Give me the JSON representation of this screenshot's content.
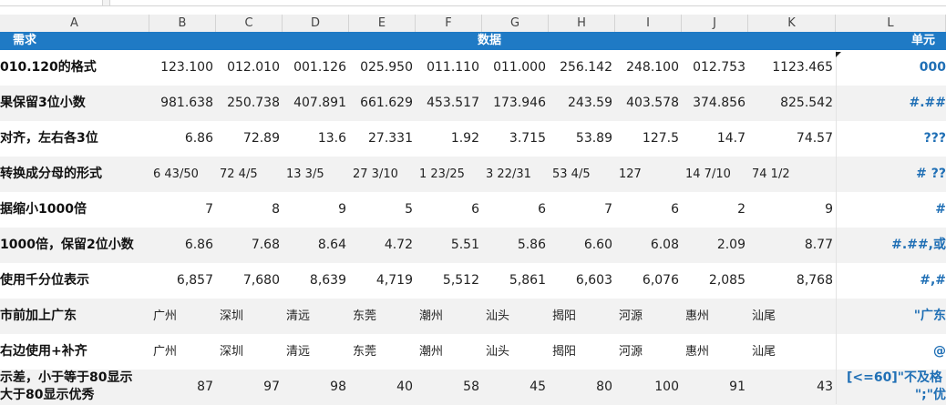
{
  "columns": [
    "A",
    "B",
    "C",
    "D",
    "E",
    "F",
    "G",
    "H",
    "I",
    "J",
    "K",
    "L"
  ],
  "banner": {
    "left": "需求",
    "center": "数据",
    "right": "单元格"
  },
  "rows": [
    {
      "label": "010.120的格式",
      "type": "num",
      "values": [
        "123.100",
        "012.010",
        "001.126",
        "025.950",
        "011.110",
        "011.000",
        "256.142",
        "248.100",
        "012.753",
        "1123.465"
      ],
      "format": "000",
      "alt": false
    },
    {
      "label": "果保留3位小数",
      "type": "num",
      "values": [
        "981.638",
        "250.738",
        "407.891",
        "661.629",
        "453.517",
        "173.946",
        "243.59",
        "403.578",
        "374.856",
        "825.542"
      ],
      "format": "#.##",
      "alt": true
    },
    {
      "label": "对齐，左右各3位",
      "type": "num",
      "values": [
        "6.86",
        "72.89",
        "13.6",
        "27.331",
        "1.92",
        "3.715",
        "53.89",
        "127.5",
        "14.7",
        "74.57"
      ],
      "format": "???",
      "alt": false
    },
    {
      "label": "转换成分母的形式",
      "type": "txt",
      "values": [
        "6 43/50",
        "72   4/5",
        "13   3/5",
        "27   3/10",
        "1 23/25",
        "3 22/31",
        "53   4/5",
        "127",
        "14   7/10",
        "74   1/2"
      ],
      "format": "# ??",
      "alt": true
    },
    {
      "label": "据缩小1000倍",
      "type": "num",
      "values": [
        "7",
        "8",
        "9",
        "5",
        "6",
        "6",
        "7",
        "6",
        "2",
        "9"
      ],
      "format": "#",
      "alt": false
    },
    {
      "label": "1000倍，保留2位小数",
      "type": "num",
      "values": [
        "6.86",
        "7.68",
        "8.64",
        "4.72",
        "5.51",
        "5.86",
        "6.60",
        "6.08",
        "2.09",
        "8.77"
      ],
      "format": "#.##,或",
      "alt": true
    },
    {
      "label": "使用千分位表示",
      "type": "num",
      "values": [
        "6,857",
        "7,680",
        "8,639",
        "4,719",
        "5,512",
        "5,861",
        "6,603",
        "6,076",
        "2,085",
        "8,768"
      ],
      "format": "#,#",
      "alt": false
    },
    {
      "label": "市前加上广东",
      "type": "txt",
      "values": [
        "广州",
        "深圳",
        "清远",
        "东莞",
        "潮州",
        "汕头",
        "揭阳",
        "河源",
        "惠州",
        "汕尾"
      ],
      "format": "\"广东",
      "alt": true
    },
    {
      "label": "右边使用+补齐",
      "type": "txt",
      "values": [
        "广州",
        "深圳",
        "清远",
        "东莞",
        "潮州",
        "汕头",
        "揭阳",
        "河源",
        "惠州",
        "汕尾"
      ],
      "format": "@",
      "alt": false
    },
    {
      "label": "示差，小于等于80显示",
      "label2": "大于80显示优秀",
      "type": "num",
      "values": [
        "87",
        "97",
        "98",
        "40",
        "58",
        "45",
        "80",
        "100",
        "91",
        "43"
      ],
      "format": "[<=60]\"不及格",
      "format2": "\";\"优",
      "alt": true
    }
  ]
}
